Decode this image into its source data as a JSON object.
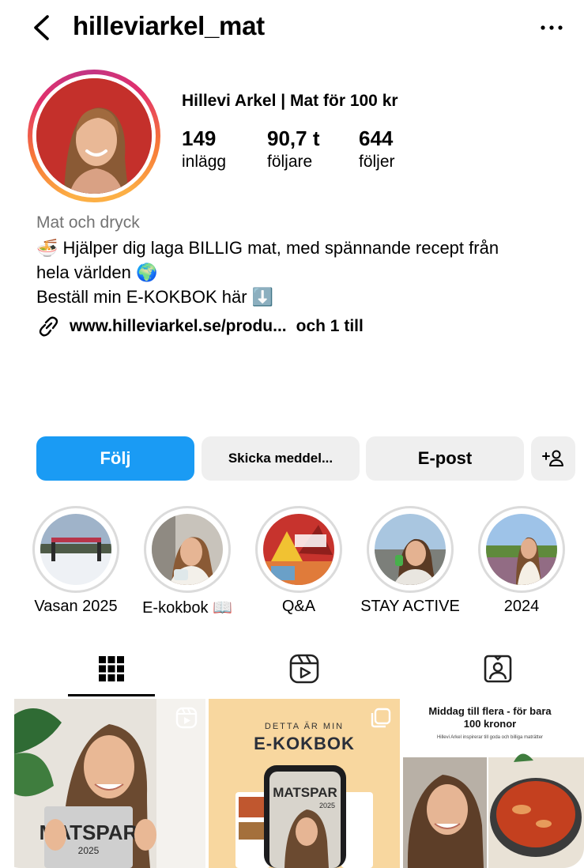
{
  "header": {
    "username": "hilleviarkel_mat",
    "back_icon": "chevron-left-icon",
    "more_icon": "more-horizontal-icon"
  },
  "profile": {
    "full_name": "Hillevi Arkel | Mat för 100 kr",
    "stats": [
      {
        "value": "149",
        "label": "inlägg"
      },
      {
        "value": "90,7 t",
        "label": "följare"
      },
      {
        "value": "644",
        "label": "följer"
      }
    ],
    "category": "Mat och dryck",
    "bio_lines": [
      "🍜 Hjälper dig laga BILLIG mat, med spännande recept från",
      "hela världen 🌍",
      "Beställ min E-KOKBOK här ⬇️"
    ],
    "link": "www.hilleviarkel.se/produ...",
    "link_extra": "och 1 till"
  },
  "actions": {
    "follow": "Följ",
    "message": "Skicka meddel...",
    "email": "E-post",
    "add_user_icon": "add-user-icon"
  },
  "highlights": [
    {
      "label": "Vasan 2025"
    },
    {
      "label": "E-kokbok 📖"
    },
    {
      "label": "Q&A"
    },
    {
      "label": "STAY ACTIVE"
    },
    {
      "label": "2024"
    }
  ],
  "tabs": [
    {
      "icon": "grid-icon",
      "active": true
    },
    {
      "icon": "reels-icon",
      "active": false
    },
    {
      "icon": "tagged-icon",
      "active": false
    }
  ],
  "posts": [
    {
      "type": "reel",
      "cover_text": "MATSPAR",
      "cover_year": "2025"
    },
    {
      "type": "carousel",
      "pre_title": "DETTA ÄR MIN",
      "title": "E-KOKBOK",
      "book": "MATSPAR",
      "year": "2025"
    },
    {
      "type": "carousel",
      "title": "Middag till flera - för bara 100 kronor",
      "subtitle": "Hillevi Arkel inspirerar till goda och billiga maträtter"
    }
  ],
  "colors": {
    "follow_button": "#1a9bf4",
    "secondary_button": "#efefef",
    "category_text": "#737373"
  }
}
